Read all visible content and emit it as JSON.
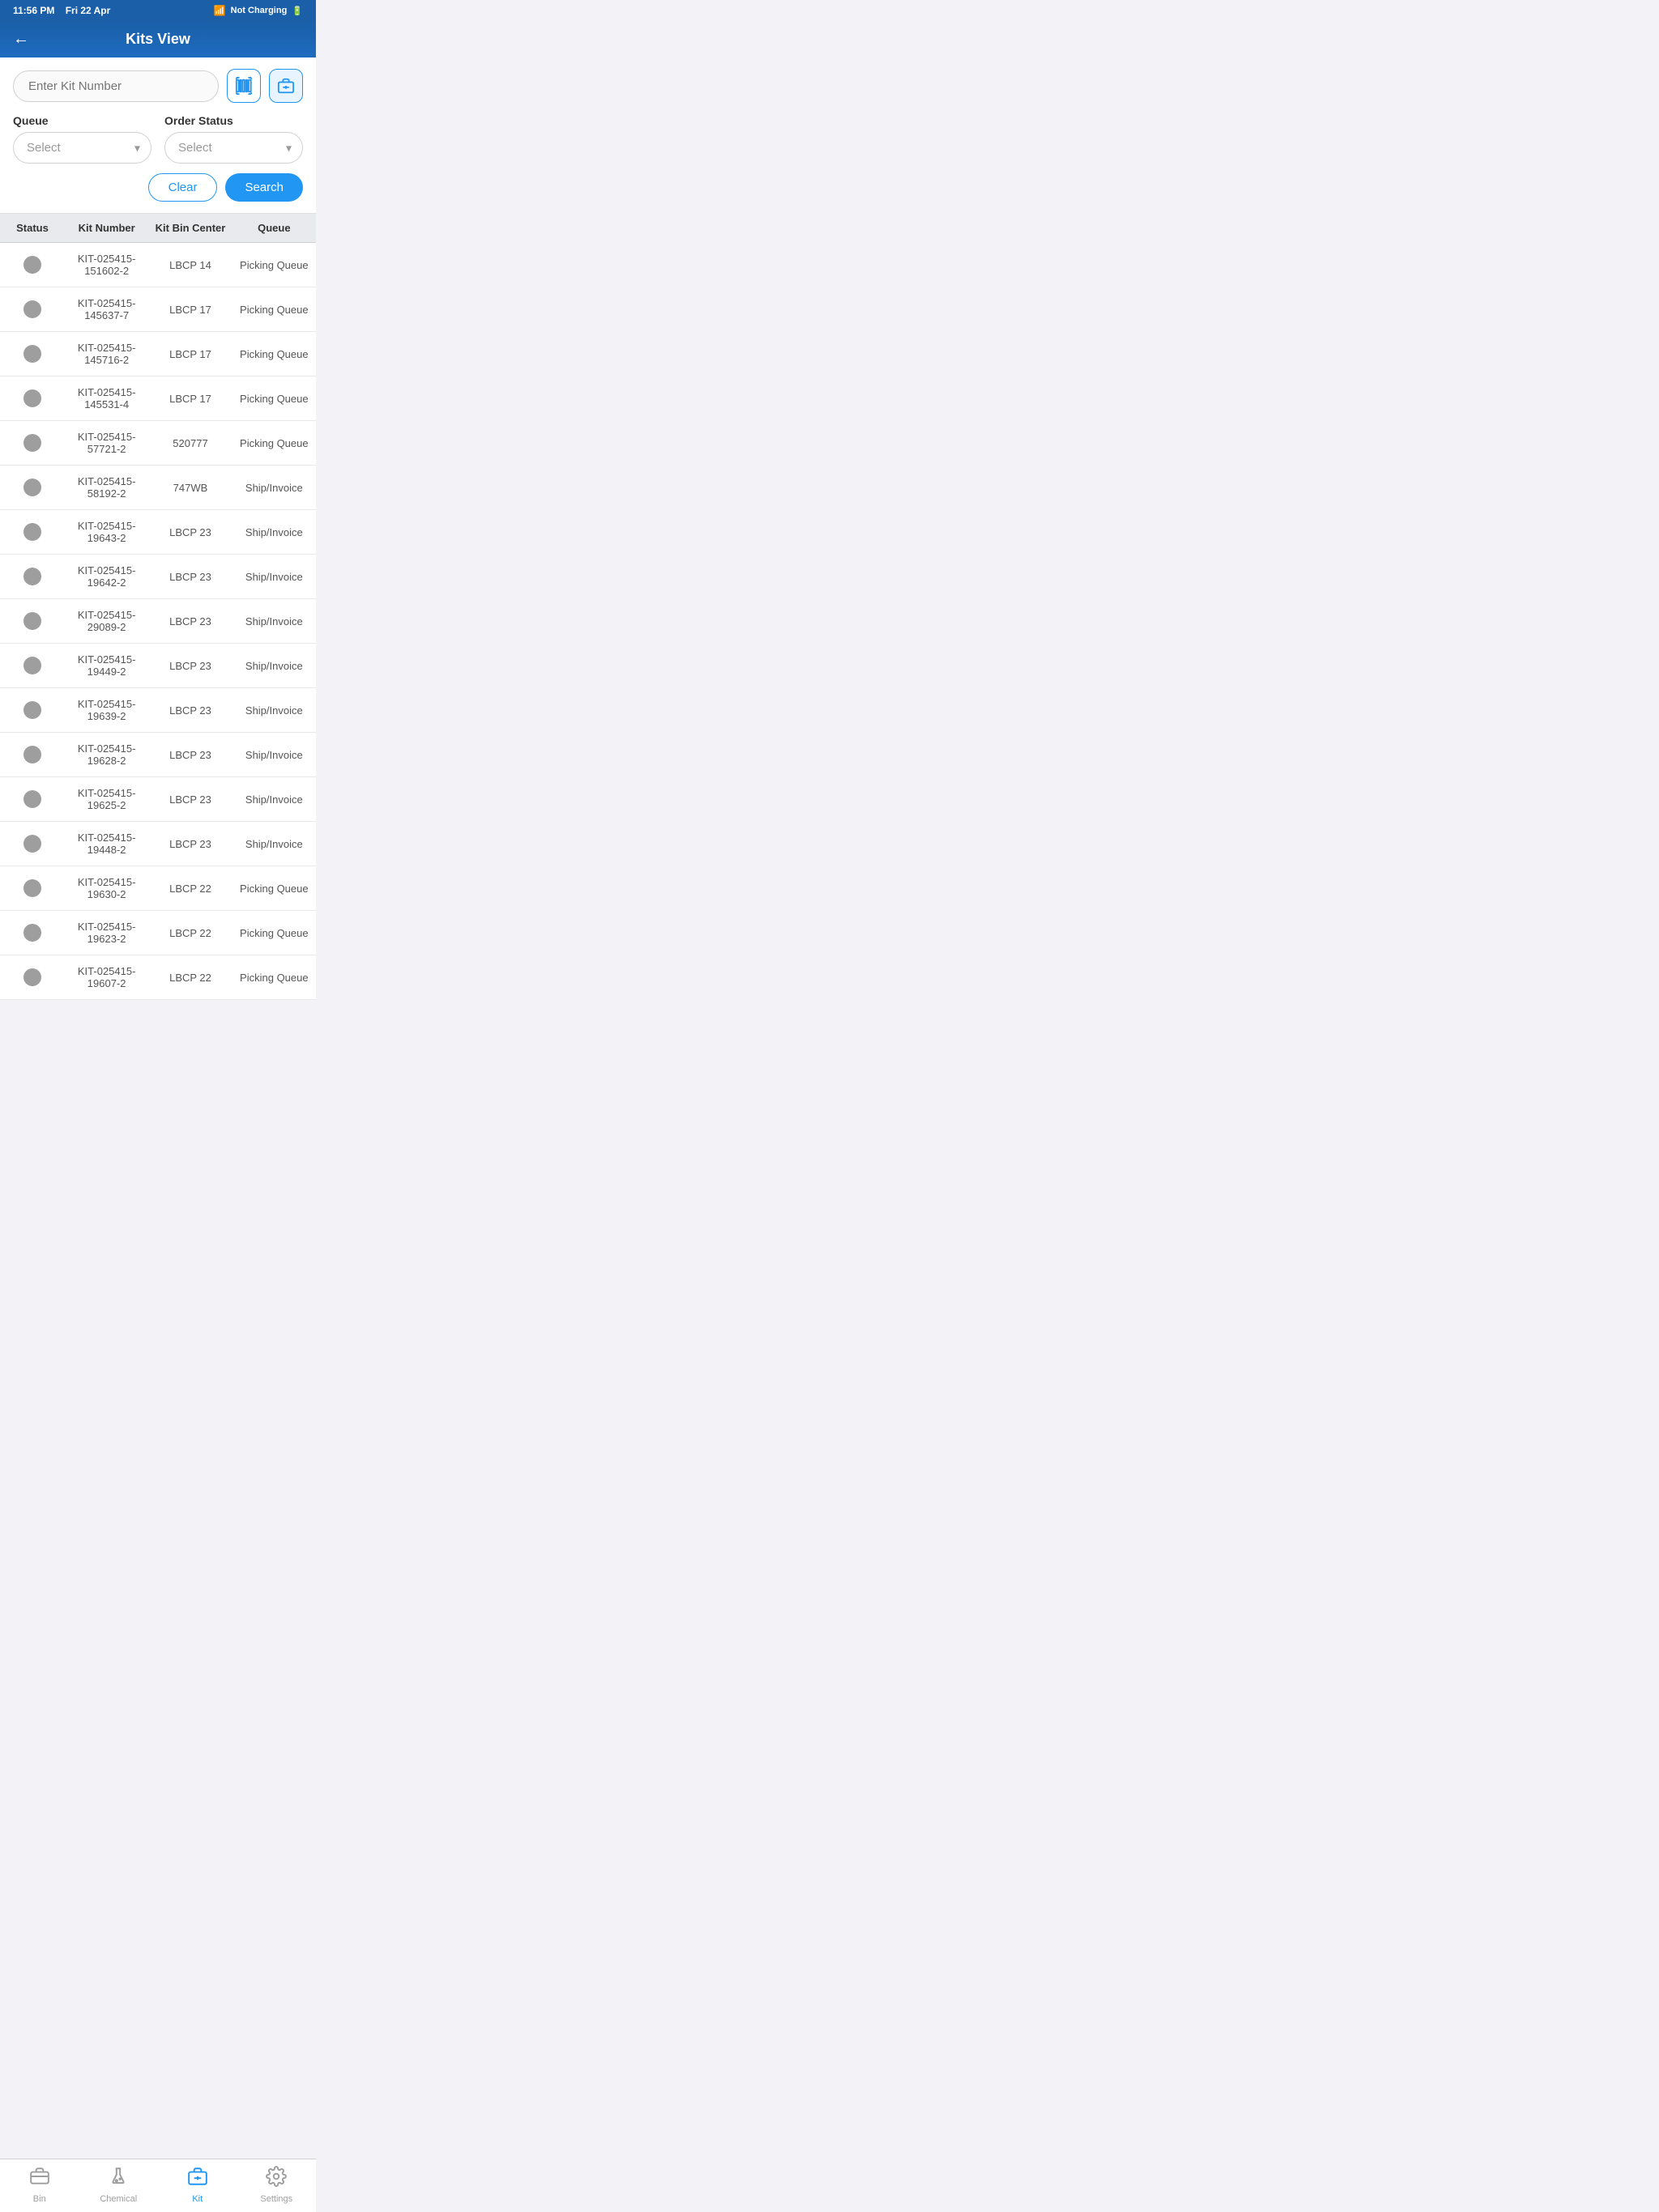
{
  "statusBar": {
    "time": "11:56 PM",
    "day": "Fri 22 Apr",
    "wifi": "WiFi",
    "battery": "Not Charging"
  },
  "header": {
    "title": "Kits View",
    "back": "←"
  },
  "search": {
    "kitNumberPlaceholder": "Enter Kit Number",
    "queueLabel": "Queue",
    "queuePlaceholder": "Select",
    "orderStatusLabel": "Order Status",
    "orderStatusPlaceholder": "Select",
    "clearButton": "Clear",
    "searchButton": "Search"
  },
  "table": {
    "columns": [
      "Status",
      "Kit Number",
      "Kit Bin Center",
      "Queue"
    ],
    "rows": [
      {
        "status": "gray",
        "kitNumber": "KIT-025415-151602-2",
        "kitBinCenter": "LBCP 14",
        "queue": "Picking Queue"
      },
      {
        "status": "gray",
        "kitNumber": "KIT-025415-145637-7",
        "kitBinCenter": "LBCP 17",
        "queue": "Picking Queue"
      },
      {
        "status": "gray",
        "kitNumber": "KIT-025415-145716-2",
        "kitBinCenter": "LBCP 17",
        "queue": "Picking Queue"
      },
      {
        "status": "gray",
        "kitNumber": "KIT-025415-145531-4",
        "kitBinCenter": "LBCP 17",
        "queue": "Picking Queue"
      },
      {
        "status": "gray",
        "kitNumber": "KIT-025415-57721-2",
        "kitBinCenter": "520777",
        "queue": "Picking Queue"
      },
      {
        "status": "gray",
        "kitNumber": "KIT-025415-58192-2",
        "kitBinCenter": "747WB",
        "queue": "Ship/Invoice"
      },
      {
        "status": "gray",
        "kitNumber": "KIT-025415-19643-2",
        "kitBinCenter": "LBCP 23",
        "queue": "Ship/Invoice"
      },
      {
        "status": "gray",
        "kitNumber": "KIT-025415-19642-2",
        "kitBinCenter": "LBCP 23",
        "queue": "Ship/Invoice"
      },
      {
        "status": "gray",
        "kitNumber": "KIT-025415-29089-2",
        "kitBinCenter": "LBCP 23",
        "queue": "Ship/Invoice"
      },
      {
        "status": "gray",
        "kitNumber": "KIT-025415-19449-2",
        "kitBinCenter": "LBCP 23",
        "queue": "Ship/Invoice"
      },
      {
        "status": "gray",
        "kitNumber": "KIT-025415-19639-2",
        "kitBinCenter": "LBCP 23",
        "queue": "Ship/Invoice"
      },
      {
        "status": "gray",
        "kitNumber": "KIT-025415-19628-2",
        "kitBinCenter": "LBCP 23",
        "queue": "Ship/Invoice"
      },
      {
        "status": "gray",
        "kitNumber": "KIT-025415-19625-2",
        "kitBinCenter": "LBCP 23",
        "queue": "Ship/Invoice"
      },
      {
        "status": "gray",
        "kitNumber": "KIT-025415-19448-2",
        "kitBinCenter": "LBCP 23",
        "queue": "Ship/Invoice"
      },
      {
        "status": "gray",
        "kitNumber": "KIT-025415-19630-2",
        "kitBinCenter": "LBCP 22",
        "queue": "Picking Queue"
      },
      {
        "status": "gray",
        "kitNumber": "KIT-025415-19623-2",
        "kitBinCenter": "LBCP 22",
        "queue": "Picking Queue"
      },
      {
        "status": "gray",
        "kitNumber": "KIT-025415-19607-2",
        "kitBinCenter": "LBCP 22",
        "queue": "Picking Queue"
      }
    ]
  },
  "bottomNav": {
    "items": [
      {
        "id": "bin",
        "label": "Bin",
        "active": false
      },
      {
        "id": "chemical",
        "label": "Chemical",
        "active": false
      },
      {
        "id": "kit",
        "label": "Kit",
        "active": true
      },
      {
        "id": "settings",
        "label": "Settings",
        "active": false
      }
    ]
  }
}
